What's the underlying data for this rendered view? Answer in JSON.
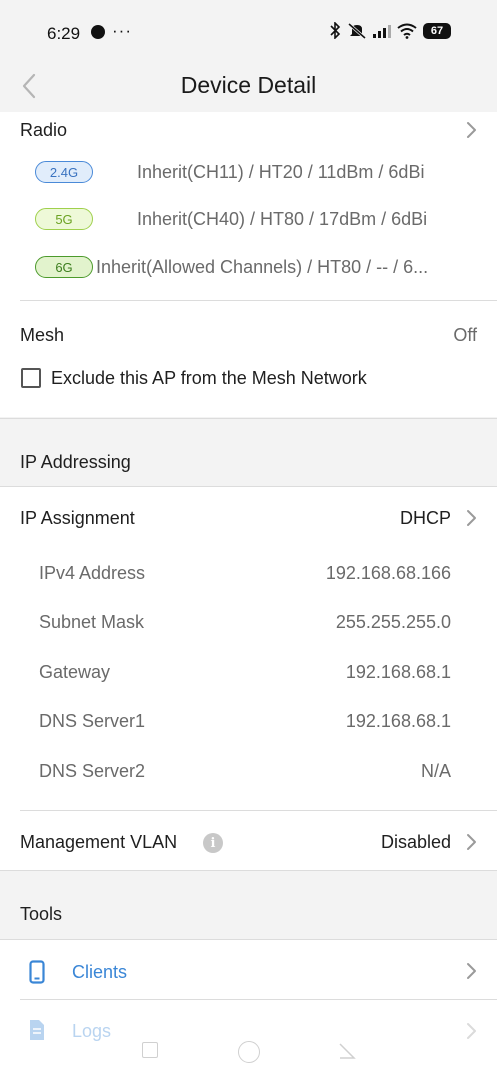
{
  "status_bar": {
    "time": "6:29",
    "more": "···",
    "battery": "67"
  },
  "header": {
    "title": "Device Detail"
  },
  "radio": {
    "label": "Radio",
    "bands": [
      {
        "badge": "2.4G",
        "detail": "Inherit(CH11) / HT20 / 11dBm / 6dBi"
      },
      {
        "badge": "5G",
        "detail": "Inherit(CH40) / HT80 / 17dBm / 6dBi"
      },
      {
        "badge": "6G",
        "detail": "Inherit(Allowed Channels) / HT80 / -- / 6..."
      }
    ]
  },
  "mesh": {
    "label": "Mesh",
    "value": "Off",
    "exclude_label": "Exclude this AP from the Mesh Network"
  },
  "ip_addressing": {
    "heading": "IP Addressing",
    "assignment_label": "IP Assignment",
    "assignment_value": "DHCP",
    "rows": [
      {
        "label": "IPv4 Address",
        "value": "192.168.68.166"
      },
      {
        "label": "Subnet Mask",
        "value": "255.255.255.0"
      },
      {
        "label": "Gateway",
        "value": "192.168.68.1"
      },
      {
        "label": "DNS Server1",
        "value": "192.168.68.1"
      },
      {
        "label": "DNS Server2",
        "value": "N/A"
      }
    ],
    "vlan_label": "Management VLAN",
    "vlan_value": "Disabled"
  },
  "tools": {
    "heading": "Tools",
    "items": [
      {
        "label": "Clients"
      },
      {
        "label": "Logs"
      }
    ]
  },
  "colors": {
    "accent": "#3a86d6",
    "badge_24g": "#4a8ad8",
    "badge_5g": "#9fd04c",
    "badge_6g": "#4c9a2c"
  },
  "icons": [
    "messenger-icon",
    "bluetooth-icon",
    "mute-icon",
    "signal-icon",
    "wifi-icon",
    "battery-icon",
    "back-icon",
    "chevron-right-icon",
    "info-icon",
    "phone-icon",
    "document-icon"
  ]
}
